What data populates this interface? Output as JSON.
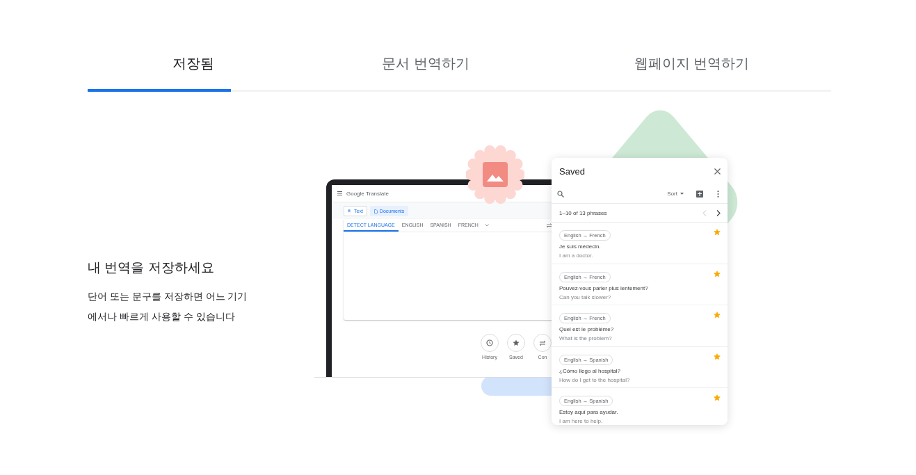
{
  "tabs": [
    {
      "label": "저장됨",
      "selected": true
    },
    {
      "label": "문서 번역하기",
      "selected": false
    },
    {
      "label": "웹페이지 번역하기",
      "selected": false
    }
  ],
  "feature": {
    "heading": "내 번역을 저장하세요",
    "description": "단어 또는 문구를 저장하면 어느 기기에서나 빠르게 사용할 수 있습니다"
  },
  "app": {
    "title": "Google Translate",
    "mode_tabs": [
      {
        "label": "Text",
        "selected": false
      },
      {
        "label": "Documents",
        "selected": true
      }
    ],
    "languages": [
      {
        "label": "DETECT LANGUAGE",
        "selected": true
      },
      {
        "label": "ENGLISH",
        "selected": false
      },
      {
        "label": "SPANISH",
        "selected": false
      },
      {
        "label": "FRENCH",
        "selected": false
      }
    ],
    "actions": [
      {
        "label": "History"
      },
      {
        "label": "Saved"
      },
      {
        "label": "Con"
      }
    ]
  },
  "saved_panel": {
    "title": "Saved",
    "sort_label": "Sort",
    "pager": "1–10 of 13 phrases",
    "phrases": [
      {
        "languages": "English → French",
        "source": "Je suis médecin.",
        "translation": "I am a doctor.",
        "starred": true
      },
      {
        "languages": "English → French",
        "source": "Pouvez-vous parler plus lentement?",
        "translation": "Can you talk slower?",
        "starred": true
      },
      {
        "languages": "English → French",
        "source": "Quel est le problème?",
        "translation": "What is the problem?",
        "starred": true
      },
      {
        "languages": "English → Spanish",
        "source": "¿Cómo llego al hospital?",
        "translation": "How do I get to the hospital?",
        "starred": true
      },
      {
        "languages": "English → Spanish",
        "source": "Estoy aquí para ayudar.",
        "translation": "I am here to help.",
        "starred": true
      }
    ]
  }
}
